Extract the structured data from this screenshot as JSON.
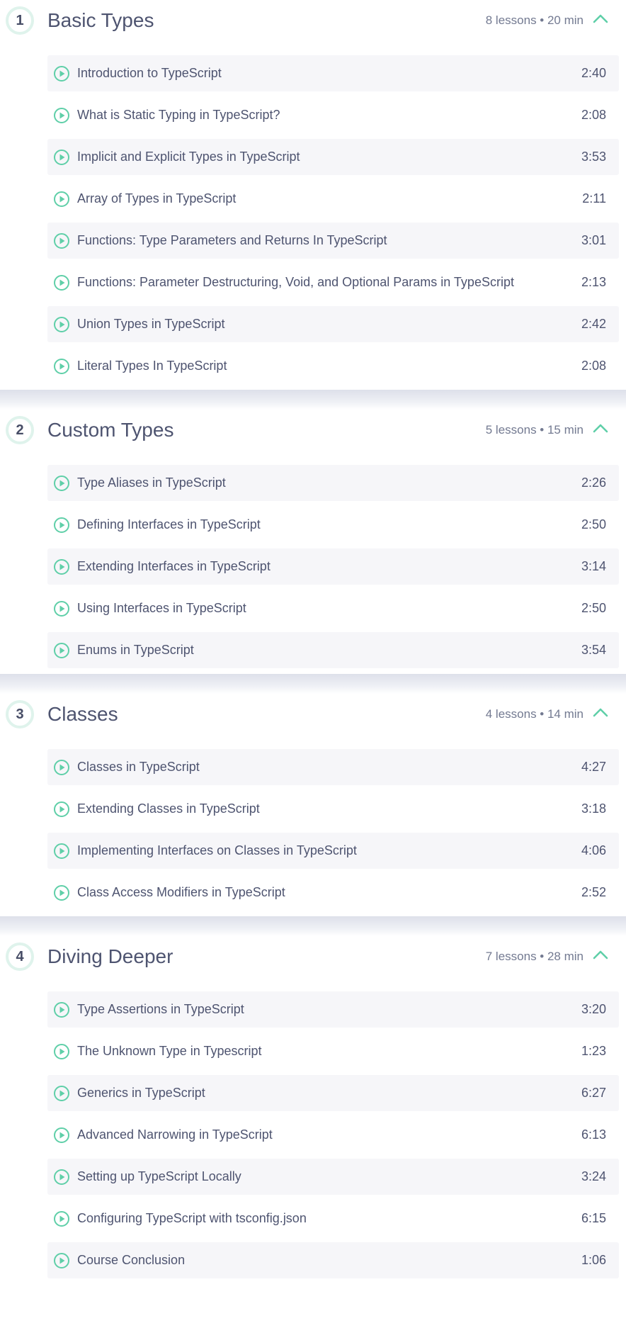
{
  "sections": [
    {
      "number": "1",
      "title": "Basic Types",
      "meta": "8 lessons • 20 min",
      "lessons": [
        {
          "title": "Introduction to TypeScript",
          "duration": "2:40"
        },
        {
          "title": "What is Static Typing in TypeScript?",
          "duration": "2:08"
        },
        {
          "title": "Implicit and Explicit Types in TypeScript",
          "duration": "3:53"
        },
        {
          "title": "Array of Types in TypeScript",
          "duration": "2:11"
        },
        {
          "title": "Functions: Type Parameters and Returns In TypeScript",
          "duration": "3:01"
        },
        {
          "title": "Functions: Parameter Destructuring, Void, and Optional Params in TypeScript",
          "duration": "2:13"
        },
        {
          "title": "Union Types in TypeScript",
          "duration": "2:42"
        },
        {
          "title": "Literal Types In TypeScript",
          "duration": "2:08"
        }
      ]
    },
    {
      "number": "2",
      "title": "Custom Types",
      "meta": "5 lessons • 15 min",
      "lessons": [
        {
          "title": "Type Aliases in TypeScript",
          "duration": "2:26"
        },
        {
          "title": "Defining Interfaces in TypeScript",
          "duration": "2:50"
        },
        {
          "title": "Extending Interfaces in TypeScript",
          "duration": "3:14"
        },
        {
          "title": "Using Interfaces in TypeScript",
          "duration": "2:50"
        },
        {
          "title": "Enums in TypeScript",
          "duration": "3:54"
        }
      ]
    },
    {
      "number": "3",
      "title": "Classes",
      "meta": "4 lessons • 14 min",
      "lessons": [
        {
          "title": "Classes in TypeScript",
          "duration": "4:27"
        },
        {
          "title": "Extending Classes in TypeScript",
          "duration": "3:18"
        },
        {
          "title": "Implementing Interfaces on Classes in TypeScript",
          "duration": "4:06"
        },
        {
          "title": "Class Access Modifiers in TypeScript",
          "duration": "2:52"
        }
      ]
    },
    {
      "number": "4",
      "title": "Diving Deeper",
      "meta": "7 lessons • 28 min",
      "lessons": [
        {
          "title": "Type Assertions in TypeScript",
          "duration": "3:20"
        },
        {
          "title": "The Unknown Type in Typescript",
          "duration": "1:23"
        },
        {
          "title": "Generics in TypeScript",
          "duration": "6:27"
        },
        {
          "title": "Advanced Narrowing in TypeScript",
          "duration": "6:13"
        },
        {
          "title": "Setting up TypeScript Locally",
          "duration": "3:24"
        },
        {
          "title": "Configuring TypeScript with tsconfig.json",
          "duration": "6:15"
        },
        {
          "title": "Course Conclusion",
          "duration": "1:06"
        }
      ]
    }
  ],
  "colors": {
    "accent": "#5fcfa8",
    "row_alt": "#f6f6f9",
    "text": "#4e5470"
  },
  "icons": {
    "lesson": "play-circle-icon",
    "collapse": "chevron-up-icon"
  }
}
